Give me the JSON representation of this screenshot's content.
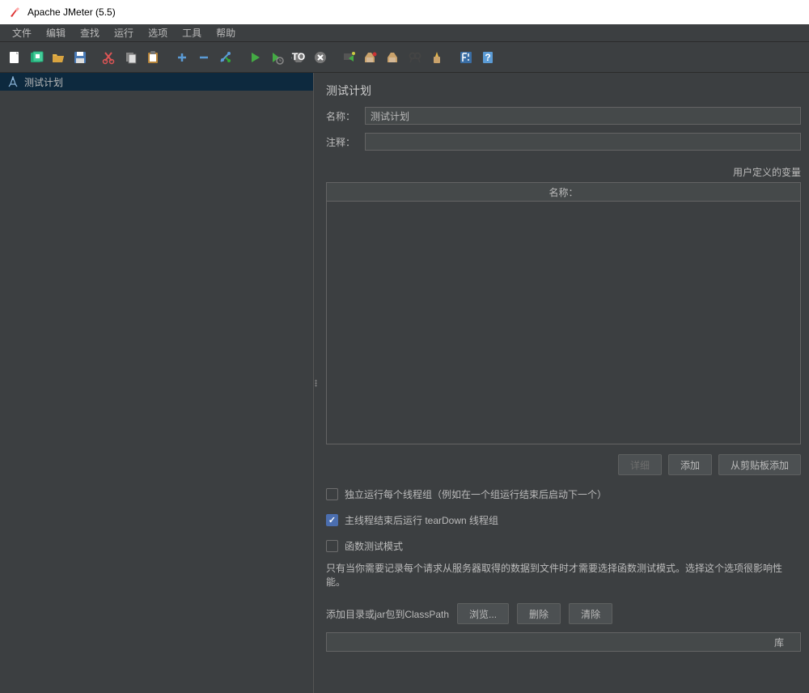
{
  "title": "Apache JMeter (5.5)",
  "menu": [
    "文件",
    "编辑",
    "查找",
    "运行",
    "选项",
    "工具",
    "帮助"
  ],
  "tree": {
    "root": "测试计划"
  },
  "panel": {
    "heading": "测试计划",
    "name_label": "名称：",
    "name_value": "测试计划",
    "comment_label": "注释：",
    "comment_value": "",
    "vars_section": "用户定义的变量",
    "vars_col_name": "名称：",
    "btn_detail": "详细",
    "btn_add": "添加",
    "btn_clip": "从剪贴板添加",
    "cb1": "独立运行每个线程组（例如在一个组运行结束后启动下一个）",
    "cb2": "主线程结束后运行 tearDown 线程组",
    "cb3": "函数测试模式",
    "help": "只有当你需要记录每个请求从服务器取得的数据到文件时才需要选择函数测试模式。选择这个选项很影响性能。",
    "classpath_label": "添加目录或jar包到ClassPath",
    "btn_browse": "浏览...",
    "btn_delete": "删除",
    "btn_clear": "清除",
    "lib_col": "库"
  }
}
